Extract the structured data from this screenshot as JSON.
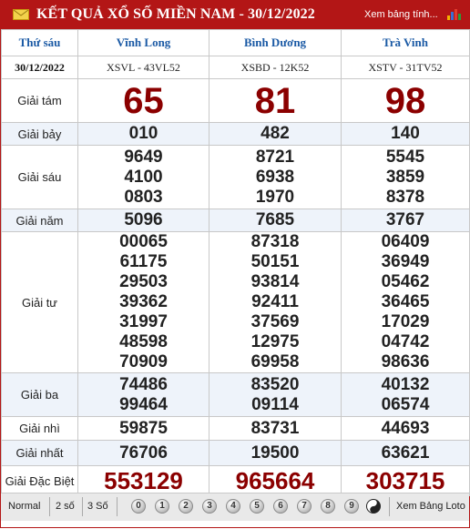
{
  "header": {
    "title": "KẾT QUẢ XỔ SỐ MIỀN NAM - 30/12/2022",
    "link": "Xem bảng tính...",
    "icon": "mail-icon",
    "chart_icon": "bar-chart-icon"
  },
  "columns": {
    "label_head": "Thứ sáu",
    "date": "30/12/2022",
    "provinces": [
      {
        "name": "Vĩnh Long",
        "code": "XSVL - 43VL52"
      },
      {
        "name": "Bình Dương",
        "code": "XSBD - 12K52"
      },
      {
        "name": "Trà Vinh",
        "code": "XSTV - 31TV52"
      }
    ]
  },
  "prizes": {
    "g8": {
      "label": "Giải tám",
      "values": [
        "65",
        "81",
        "98"
      ]
    },
    "g7": {
      "label": "Giải bảy",
      "values": [
        "010",
        "482",
        "140"
      ]
    },
    "g6": {
      "label": "Giải sáu",
      "values": [
        [
          "9649",
          "4100",
          "0803"
        ],
        [
          "8721",
          "6938",
          "1970"
        ],
        [
          "5545",
          "3859",
          "8378"
        ]
      ]
    },
    "g5": {
      "label": "Giải năm",
      "values": [
        "5096",
        "7685",
        "3767"
      ]
    },
    "g4": {
      "label": "Giải tư",
      "values": [
        [
          "00065",
          "61175",
          "29503",
          "39362",
          "31997",
          "48598",
          "70909"
        ],
        [
          "87318",
          "50151",
          "93814",
          "92411",
          "37569",
          "12975",
          "69958"
        ],
        [
          "06409",
          "36949",
          "05462",
          "36465",
          "17029",
          "04742",
          "98636"
        ]
      ]
    },
    "g3": {
      "label": "Giải ba",
      "values": [
        [
          "74486",
          "99464"
        ],
        [
          "83520",
          "09114"
        ],
        [
          "40132",
          "06574"
        ]
      ]
    },
    "g2": {
      "label": "Giải nhì",
      "values": [
        "59875",
        "83731",
        "44693"
      ]
    },
    "g1": {
      "label": "Giải nhất",
      "values": [
        "76706",
        "19500",
        "63621"
      ]
    },
    "db": {
      "label": "Giải Đặc Biệt",
      "values": [
        "553129",
        "965664",
        "303715"
      ]
    }
  },
  "footer": {
    "modes": [
      "Normal",
      "2 số",
      "3 Số"
    ],
    "digits": [
      "0",
      "1",
      "2",
      "3",
      "4",
      "5",
      "6",
      "7",
      "8",
      "9"
    ],
    "yin_yang_icon": "yin-yang-icon",
    "loto_link": "Xem Bảng Loto"
  },
  "colors": {
    "brand": "#b31616",
    "highlight": "#8b0000",
    "head_text": "#1b5aa5"
  }
}
